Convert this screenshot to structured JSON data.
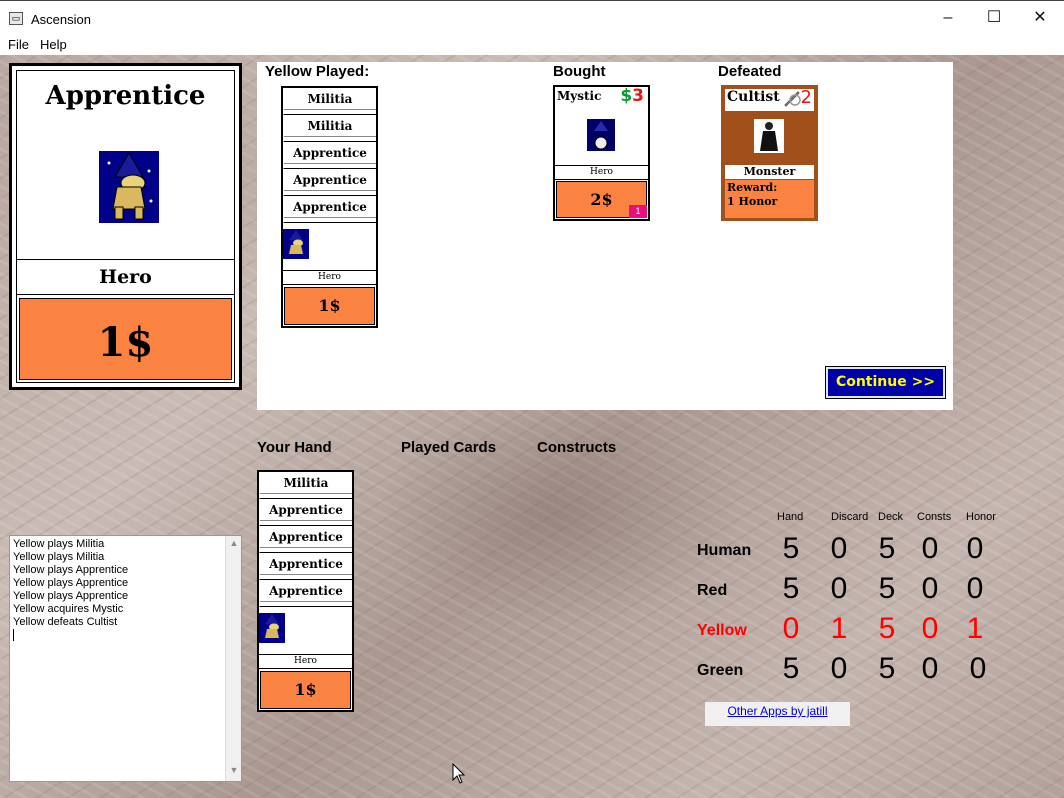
{
  "window": {
    "title": "Ascension",
    "minimize": "–",
    "maximize": "☐",
    "close": "✕"
  },
  "menu": [
    "File",
    "Help"
  ],
  "focus_card": {
    "name": "Apprentice",
    "type": "Hero",
    "cost": "1$"
  },
  "play_area": {
    "played_header": "Yellow Played:",
    "bought_header": "Bought",
    "defeated_header": "Defeated",
    "played_cards": [
      "Militia",
      "Militia",
      "Apprentice",
      "Apprentice",
      "Apprentice"
    ],
    "played_top": {
      "type": "Hero",
      "cost": "1$"
    },
    "bought_card": {
      "name": "Mystic",
      "cost_symbol": "$",
      "cost": "3",
      "type": "Hero",
      "value": "2$",
      "badge": "1"
    },
    "defeated_card": {
      "name": "Cultist",
      "power": "2",
      "type": "Monster",
      "reward_label": "Reward:",
      "reward": "1 Honor"
    },
    "continue_button": "Continue >>"
  },
  "hand": {
    "your_hand_header": "Your Hand",
    "played_cards_header": "Played Cards",
    "constructs_header": "Constructs",
    "cards": [
      "Militia",
      "Apprentice",
      "Apprentice",
      "Apprentice",
      "Apprentice"
    ],
    "top": {
      "type": "Hero",
      "cost": "1$"
    }
  },
  "log": [
    "Yellow plays Militia",
    "Yellow plays Militia",
    "Yellow plays Apprentice",
    "Yellow plays Apprentice",
    "Yellow plays Apprentice",
    "Yellow acquires Mystic",
    "Yellow defeats Cultist"
  ],
  "scores": {
    "columns": [
      "Hand",
      "Discard",
      "Deck",
      "Consts",
      "Honor"
    ],
    "rows": [
      {
        "name": "Human",
        "values": [
          "5",
          "0",
          "5",
          "0",
          "0"
        ]
      },
      {
        "name": "Red",
        "values": [
          "5",
          "0",
          "5",
          "0",
          "0"
        ]
      },
      {
        "name": "Yellow",
        "values": [
          "0",
          "1",
          "5",
          "0",
          "1"
        ]
      },
      {
        "name": "Green",
        "values": [
          "5",
          "0",
          "5",
          "0",
          "0"
        ]
      }
    ],
    "highlight_color": "#ff0000"
  },
  "other_apps": "Other Apps by jatill",
  "colors": {
    "cost_orange": "#fb8341",
    "continue_bg": "#0000a8",
    "continue_text": "#ffff00",
    "monster_brown": "#a1501c"
  }
}
